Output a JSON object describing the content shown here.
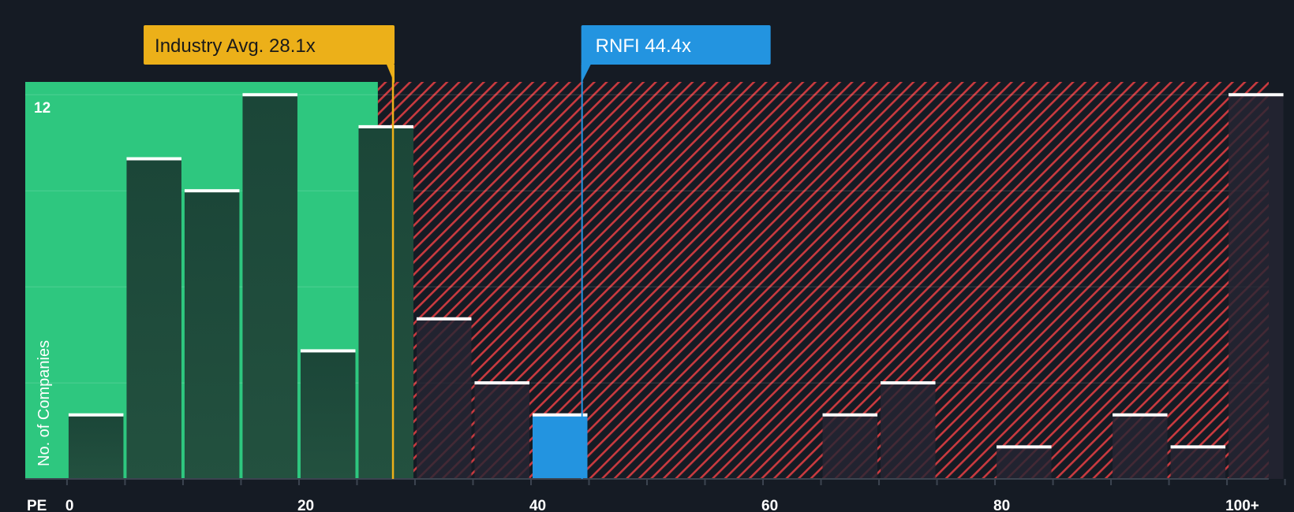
{
  "chart_data": {
    "type": "bar",
    "title": "",
    "xlabel": "PE",
    "ylabel": "No. of Companies",
    "x_ticks": [
      {
        "value": 0,
        "label": "0"
      },
      {
        "value": 20,
        "label": "20"
      },
      {
        "value": 40,
        "label": "40"
      },
      {
        "value": 60,
        "label": "60"
      },
      {
        "value": 80,
        "label": "80"
      },
      {
        "value": 100,
        "label": "100+"
      }
    ],
    "xlim": [
      -3.6,
      103.6
    ],
    "ylim": [
      0,
      12.4
    ],
    "y_max_label": "12",
    "bins": [
      {
        "start": 0,
        "end": 5,
        "count": 2
      },
      {
        "start": 5,
        "end": 10,
        "count": 10
      },
      {
        "start": 10,
        "end": 15,
        "count": 9
      },
      {
        "start": 15,
        "end": 20,
        "count": 12
      },
      {
        "start": 20,
        "end": 25,
        "count": 4
      },
      {
        "start": 25,
        "end": 30,
        "count": 11
      },
      {
        "start": 30,
        "end": 35,
        "count": 5
      },
      {
        "start": 35,
        "end": 40,
        "count": 3
      },
      {
        "start": 40,
        "end": 45,
        "count": 2,
        "highlight": true
      },
      {
        "start": 45,
        "end": 50,
        "count": 0
      },
      {
        "start": 50,
        "end": 55,
        "count": 0
      },
      {
        "start": 55,
        "end": 60,
        "count": 0
      },
      {
        "start": 60,
        "end": 65,
        "count": 0
      },
      {
        "start": 65,
        "end": 70,
        "count": 2
      },
      {
        "start": 70,
        "end": 75,
        "count": 3
      },
      {
        "start": 75,
        "end": 80,
        "count": 0
      },
      {
        "start": 80,
        "end": 85,
        "count": 1
      },
      {
        "start": 85,
        "end": 90,
        "count": 0
      },
      {
        "start": 90,
        "end": 95,
        "count": 2
      },
      {
        "start": 95,
        "end": 100,
        "count": 1
      },
      {
        "start": 100,
        "end": 105,
        "count": 12
      }
    ],
    "fair_zone_end": 26.8,
    "industry_avg": {
      "value": 28.1,
      "label": "Industry Avg. 28.1x"
    },
    "company": {
      "value": 44.4,
      "label": "RNFI 44.4x"
    },
    "grid": true,
    "colors": {
      "background": "#151b24",
      "fair_zone": "#2ec77f",
      "overvalued_hatch": "#c93a3f",
      "bar": "#1e4a3b",
      "bar_in_hatch": "#262633",
      "bar_cap": "#ffffff",
      "highlight_bar": "#2394e0",
      "industry_badge": "#ecb019",
      "industry_text": "#1a1a1a",
      "company_badge": "#2394e0",
      "company_text": "#ffffff"
    }
  }
}
